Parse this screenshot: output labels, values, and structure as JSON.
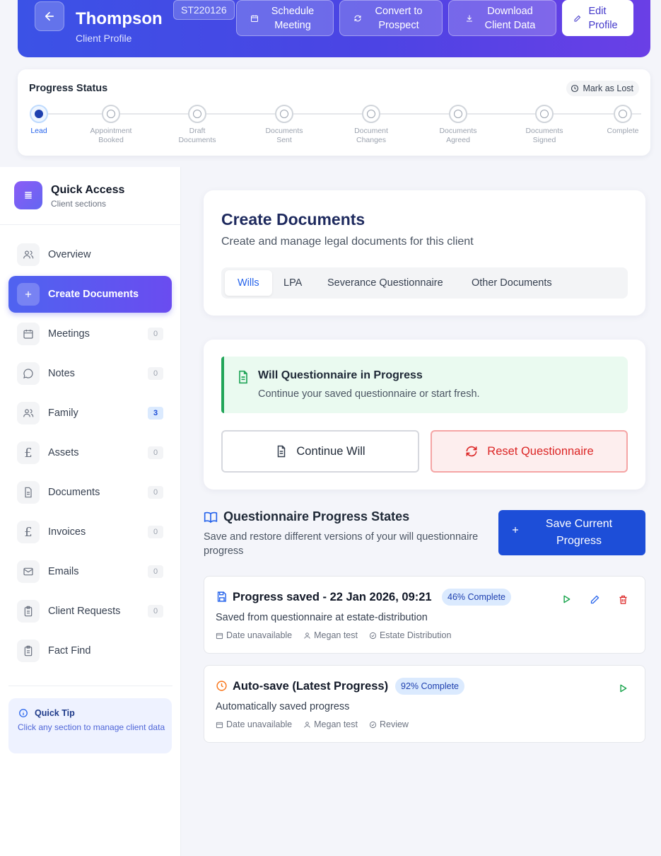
{
  "header": {
    "client_name": "Thompson",
    "client_subtitle": "Client Profile",
    "client_id": "ST220126",
    "buttons": {
      "schedule": "Schedule Meeting",
      "convert": "Convert to Prospect",
      "download": "Download Client Data",
      "edit": "Edit Profile"
    }
  },
  "progress": {
    "title": "Progress Status",
    "mark_lost": "Mark as Lost",
    "steps": [
      "Lead",
      "Appointment Booked",
      "Draft Documents",
      "Documents Sent",
      "Document Changes",
      "Documents Agreed",
      "Documents Signed",
      "Complete"
    ],
    "active_step": "Lead"
  },
  "sidebar": {
    "title": "Quick Access",
    "subtitle": "Client sections",
    "items": [
      {
        "label": "Overview",
        "icon": "users-icon"
      },
      {
        "label": "Create Documents",
        "icon": "plus-icon",
        "active": true
      },
      {
        "label": "Meetings",
        "count": "0",
        "icon": "calendar-icon"
      },
      {
        "label": "Notes",
        "count": "0",
        "icon": "chat-icon"
      },
      {
        "label": "Family",
        "count": "3",
        "icon": "users-icon"
      },
      {
        "label": "Assets",
        "count": "0",
        "icon": "pound-icon"
      },
      {
        "label": "Documents",
        "count": "0",
        "icon": "document-icon"
      },
      {
        "label": "Invoices",
        "count": "0",
        "icon": "pound-icon"
      },
      {
        "label": "Emails",
        "count": "0",
        "icon": "mail-icon"
      },
      {
        "label": "Client Requests",
        "count": "0",
        "icon": "clipboard-icon"
      },
      {
        "label": "Fact Find",
        "icon": "clipboard-icon"
      }
    ],
    "tip": {
      "title": "Quick Tip",
      "text": "Click any section to manage client data"
    }
  },
  "create_documents": {
    "title": "Create Documents",
    "subtitle": "Create and manage legal documents for this client",
    "tabs": [
      "Wills",
      "LPA",
      "Severance Questionnaire",
      "Other Documents"
    ],
    "active_tab": "Wills"
  },
  "will_status": {
    "title": "Will Questionnaire in Progress",
    "text": "Continue your saved questionnaire or start fresh.",
    "continue_label": "Continue Will",
    "reset_label": "Reset Questionnaire"
  },
  "progress_states": {
    "title": "Questionnaire Progress States",
    "subtitle": "Save and restore different versions of your will questionnaire progress",
    "save_label": "Save Current Progress",
    "items": [
      {
        "title": "Progress saved - 22 Jan 2026, 09:21",
        "badge": "46% Complete",
        "desc": "Saved from questionnaire at estate-distribution",
        "date": "Date unavailable",
        "user": "Megan test",
        "section": "Estate Distribution"
      },
      {
        "title": "Auto-save (Latest Progress)",
        "badge": "92% Complete",
        "desc": "Automatically saved progress",
        "date": "Date unavailable",
        "user": "Megan test",
        "section": "Review"
      }
    ]
  },
  "colors": {
    "accent": "#3b52e6",
    "primary_button": "#1d4ed8",
    "success": "#22a559",
    "danger": "#dc2626"
  }
}
